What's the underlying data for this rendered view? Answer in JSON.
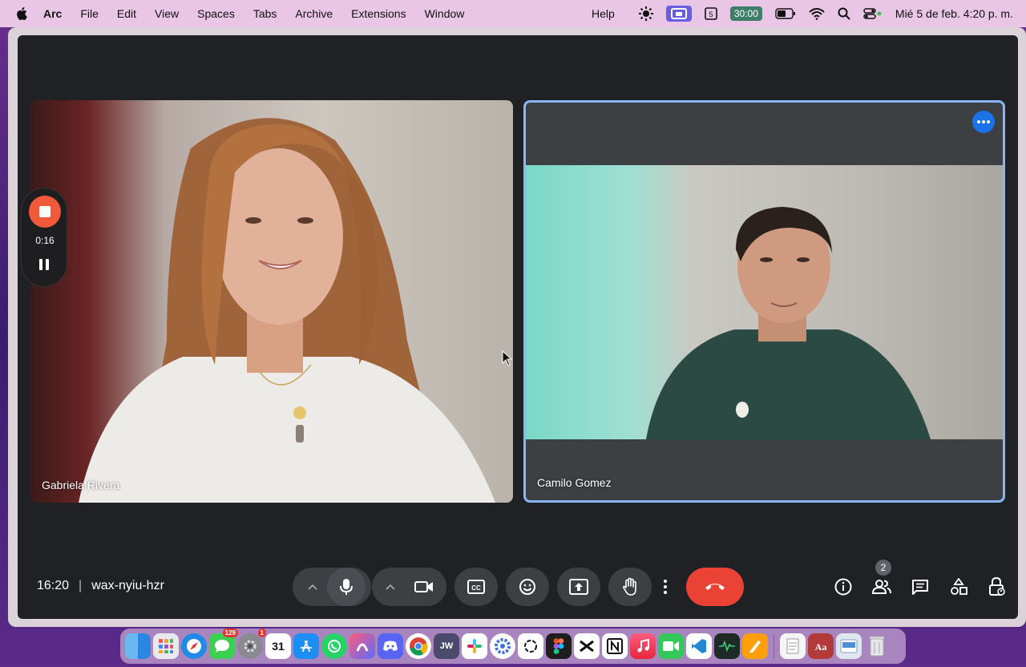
{
  "menubar": {
    "app_name": "Arc",
    "menus": [
      "File",
      "Edit",
      "View",
      "Spaces",
      "Tabs",
      "Archive",
      "Extensions",
      "Window"
    ],
    "help": "Help",
    "timer": "30:00",
    "datetime": "Mié 5 de feb. 4:20 p. m."
  },
  "recording": {
    "elapsed": "0:16"
  },
  "participants": [
    {
      "name": "Gabriela Rivera"
    },
    {
      "name": "Camilo Gomez"
    }
  ],
  "meeting": {
    "time": "16:20",
    "separator": "|",
    "code": "wax-nyiu-hzr",
    "participant_count": "2"
  },
  "colors": {
    "accent": "#8ab4f8",
    "hangup": "#ea4335",
    "record": "#f05a3a",
    "meet_bg": "#202124"
  },
  "dock": {
    "apps": [
      "Finder",
      "Launchpad",
      "Safari",
      "Messages",
      "System Settings",
      "Calendar",
      "App Store",
      "WhatsApp",
      "Arc",
      "Discord",
      "Chrome",
      "JW Library",
      "Slack",
      "Settings",
      "ChatGPT",
      "Figma",
      "CapCut",
      "Notion",
      "Music",
      "FaceTime",
      "VS Code",
      "Activity Monitor",
      "Pages",
      "TextEdit",
      "Dictionary",
      "Preview",
      "Trash"
    ],
    "calendar_day": "31",
    "messages_badge": "129",
    "settings_badge": "1",
    "jw_label": "JW"
  }
}
